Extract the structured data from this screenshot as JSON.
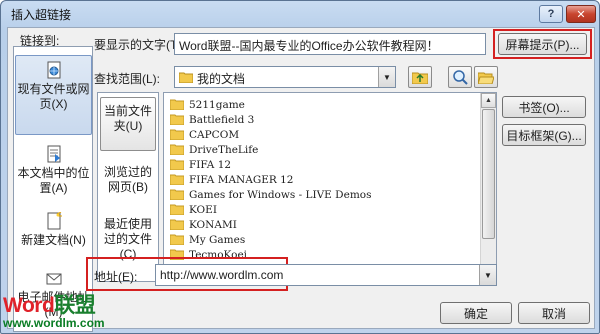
{
  "window": {
    "title": "插入超链接",
    "help_label": "?",
    "close_label": "✕"
  },
  "display_text": {
    "label": "要显示的文字(T):",
    "value": "Word联盟--国内最专业的Office办公软件教程网！"
  },
  "screen_tip_button": "屏幕提示(P)...",
  "link_to": {
    "label": "链接到:",
    "items": [
      {
        "label": "现有文件或网页(X)",
        "icon": "globe-document-icon"
      },
      {
        "label": "本文档中的位置(A)",
        "icon": "document-place-icon"
      },
      {
        "label": "新建文档(N)",
        "icon": "new-document-icon"
      },
      {
        "label": "电子邮件地址(M)",
        "icon": "email-icon"
      }
    ]
  },
  "look_in": {
    "label": "查找范围(L):",
    "value": "我的文档",
    "icon": "folder-icon"
  },
  "subnav": [
    {
      "label": "当前文件夹(U)"
    },
    {
      "label": "浏览过的网页(B)"
    },
    {
      "label": "最近使用过的文件(C)"
    }
  ],
  "files": [
    "5211game",
    "Battlefield 3",
    "CAPCOM",
    "DriveTheLife",
    "FIFA 12",
    "FIFA MANAGER 12",
    "Games for Windows - LIVE Demos",
    "KOEI",
    "KONAMI",
    "My Games",
    "TecmoKoei"
  ],
  "right_buttons": {
    "bookmark": "书签(O)...",
    "target_frame": "目标框架(G)..."
  },
  "address": {
    "label": "地址(E):",
    "value": "http://www.wordlm.com"
  },
  "footer": {
    "ok": "确定",
    "cancel": "取消"
  },
  "watermark": {
    "logo_word": "Word",
    "logo_union": "联盟",
    "url": "www.wordlm.com"
  },
  "colors": {
    "highlight": "#d42020",
    "folder": "#f2c94c",
    "title_gradient": "#c9dcf2"
  }
}
